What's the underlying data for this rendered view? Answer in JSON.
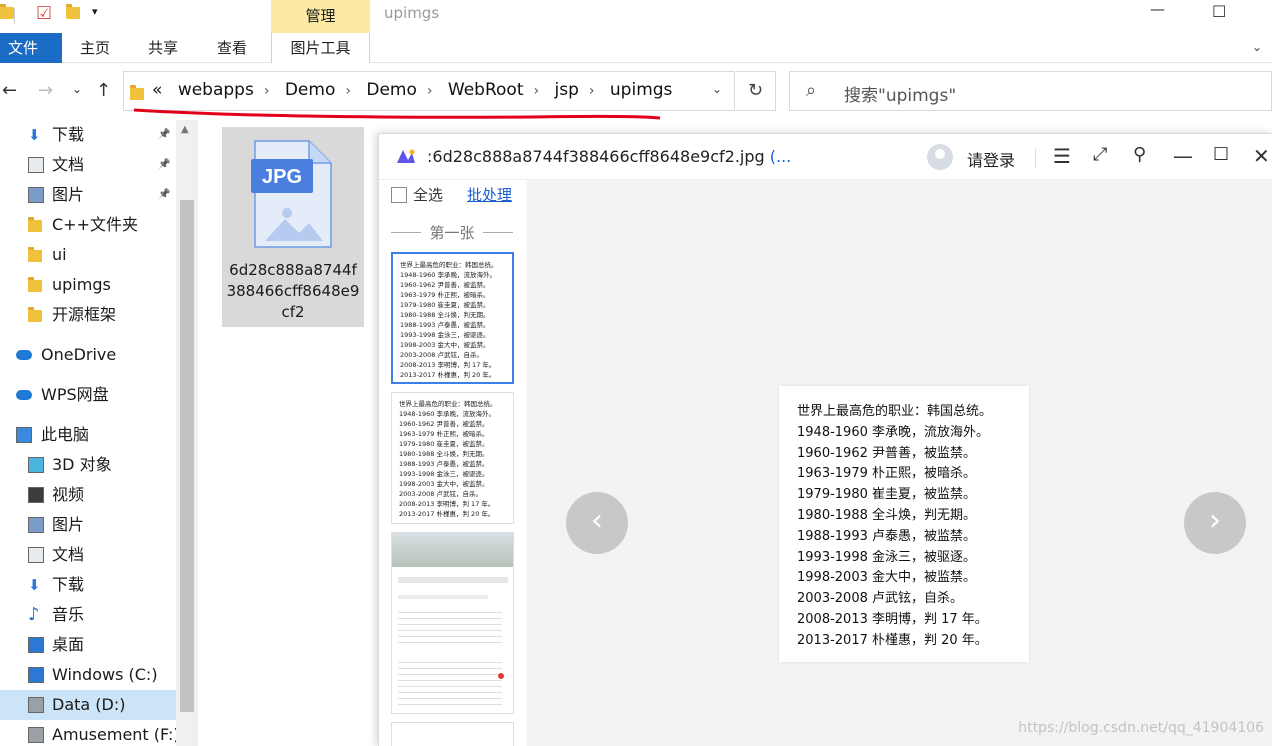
{
  "window": {
    "title": "upimgs",
    "context_header": "管理"
  },
  "ribbon": {
    "tabs": [
      "文件",
      "主页",
      "共享",
      "查看"
    ],
    "context_tab": "图片工具"
  },
  "address": {
    "prefix": "«",
    "crumbs": [
      "webapps",
      "Demo",
      "Demo",
      "WebRoot",
      "jsp",
      "upimgs"
    ]
  },
  "search": {
    "placeholder": "搜索\"upimgs\""
  },
  "sidebar": {
    "items": [
      {
        "label": "下载",
        "icon": "download-arrow-icon",
        "pinned": true
      },
      {
        "label": "文档",
        "icon": "document-icon",
        "pinned": true
      },
      {
        "label": "图片",
        "icon": "picture-icon",
        "pinned": true
      },
      {
        "label": "C++文件夹",
        "icon": "folder-icon",
        "pinned": false
      },
      {
        "label": "ui",
        "icon": "folder-icon",
        "pinned": false
      },
      {
        "label": "upimgs",
        "icon": "folder-icon",
        "pinned": false
      },
      {
        "label": "开源框架",
        "icon": "folder-icon",
        "pinned": false
      },
      {
        "label": "OneDrive",
        "icon": "cloud-icon",
        "pinned": false
      },
      {
        "label": "WPS网盘",
        "icon": "cloud-icon",
        "pinned": false
      },
      {
        "label": "此电脑",
        "icon": "computer-icon",
        "pinned": false
      },
      {
        "label": "3D 对象",
        "icon": "cube-icon",
        "pinned": false
      },
      {
        "label": "视频",
        "icon": "film-icon",
        "pinned": false
      },
      {
        "label": "图片",
        "icon": "picture-icon",
        "pinned": false
      },
      {
        "label": "文档",
        "icon": "document-icon",
        "pinned": false
      },
      {
        "label": "下载",
        "icon": "download-arrow-icon",
        "pinned": false
      },
      {
        "label": "音乐",
        "icon": "music-note-icon",
        "pinned": false
      },
      {
        "label": "桌面",
        "icon": "desktop-icon",
        "pinned": false
      },
      {
        "label": "Windows (C:)",
        "icon": "windows-drive-icon",
        "pinned": false
      },
      {
        "label": "Data (D:)",
        "icon": "drive-icon",
        "pinned": false,
        "selected": true
      },
      {
        "label": "Amusement (F:)",
        "icon": "drive-icon",
        "pinned": false
      }
    ]
  },
  "file": {
    "type_label": "JPG",
    "name": "6d28c888a8744f388466cff8648e9cf2"
  },
  "viewer": {
    "title": ":6d28c888a8744f388466cff8648e9cf2.jpg",
    "title_trunc": " (...",
    "login": "请登录",
    "select_all": "全选",
    "batch": "批处理",
    "group_label": "第一张",
    "doc_lines": [
      "世界上最高危的职业：韩国总统。",
      "1948-1960 李承晚，流放海外。",
      "1960-1962 尹普善，被监禁。",
      "1963-1979 朴正熙，被暗杀。",
      "1979-1980 崔圭夏，被监禁。",
      "1980-1988 全斗焕，判无期。",
      "1988-1993 卢泰愚，被监禁。",
      "1993-1998 金泳三，被驱逐。",
      "1998-2003 金大中，被监禁。",
      "2003-2008 卢武铉，自杀。",
      "2008-2013 李明博，判 17 年。",
      "2013-2017 朴槿惠，判 20 年。"
    ]
  },
  "watermark": "https://blog.csdn.net/qq_41904106"
}
